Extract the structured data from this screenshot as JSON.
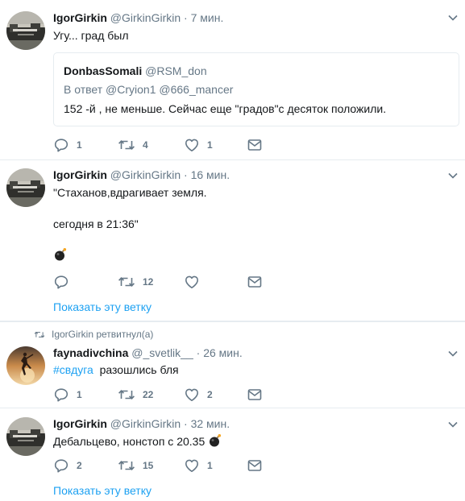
{
  "tweets": [
    {
      "name": "IgorGirkin",
      "handle": "@GirkinGirkin",
      "dot": "·",
      "time": "7 мин.",
      "text": "Угу... град был",
      "quote": {
        "name": "DonbasSomali",
        "handle": "@RSM_don",
        "reply_prefix": "В ответ",
        "reply_to_1": "@Cryion1",
        "reply_to_2": "@666_mancer",
        "text": "152 -й , не меньше. Сейчас еще \"градов\"с десяток положили."
      },
      "replies": "1",
      "retweets": "4",
      "likes": "1"
    },
    {
      "name": "IgorGirkin",
      "handle": "@GirkinGirkin",
      "dot": "·",
      "time": "16 мин.",
      "text_line1": "\"Стаханов,вдрагивает земля.",
      "text_line2": "сегодня в 21:36\"",
      "replies": "",
      "retweets": "12",
      "likes": "",
      "show_thread": "Показать эту ветку"
    },
    {
      "retweet_notice": "IgorGirkin ретвитнул(а)",
      "name": "faynadivchina",
      "handle": "@_svetlik__",
      "dot": "·",
      "time": "26 мин.",
      "hashtag": "#свдуга",
      "text": "разошлись бля",
      "replies": "1",
      "retweets": "22",
      "likes": "2"
    },
    {
      "name": "IgorGirkin",
      "handle": "@GirkinGirkin",
      "dot": "·",
      "time": "32 мин.",
      "text": "Дебальцево, нонстоп с 20.35",
      "replies": "2",
      "retweets": "15",
      "likes": "1",
      "show_thread": "Показать эту ветку"
    }
  ],
  "icons": {
    "reply": "reply-icon",
    "retweet": "retweet-icon",
    "like": "heart-icon",
    "message": "envelope-icon",
    "more": "chevron-down-icon",
    "bomb": "bomb-emoji-icon"
  },
  "colors": {
    "link": "#1da1f2",
    "secondary": "#657786",
    "border": "#e6ecf0"
  }
}
